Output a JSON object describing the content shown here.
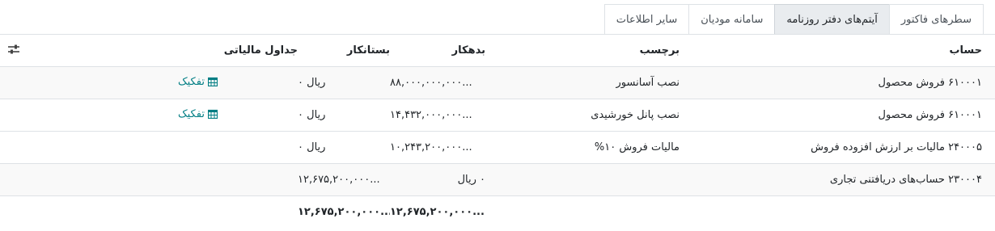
{
  "tabs": [
    {
      "label": "سطرهای فاکتور",
      "active": false
    },
    {
      "label": "آیتم‌های دفتر روزنامه",
      "active": true
    },
    {
      "label": "سامانه مودیان",
      "active": false
    },
    {
      "label": "سایر اطلاعات",
      "active": false
    }
  ],
  "table": {
    "headers": {
      "account": "حساب",
      "label": "برچسب",
      "debit": "بدهکار",
      "credit": "بستانکار",
      "tax_grids": "جداول مالیاتی"
    },
    "settings_icon": "sliders-icon",
    "rows": [
      {
        "account": "۶۱۰۰۰۱ فروش محصول",
        "label": "نصب آسانسور",
        "debit": "۸۸,۰۰۰,۰۰۰,۰۰۰...",
        "credit": "۰ ریال",
        "tax": "",
        "split": "تفکیک"
      },
      {
        "account": "۶۱۰۰۰۱ فروش محصول",
        "label": "نصب پانل خورشیدی",
        "debit": "۱۴,۴۳۲,۰۰۰,۰۰۰...",
        "credit": "۰ ریال",
        "tax": "",
        "split": "تفکیک"
      },
      {
        "account": "۲۴۰۰۰۵ مالیات بر ارزش افزوده فروش",
        "label": "مالیات فروش ۱۰%",
        "debit": "۱۰,۲۴۳,۲۰۰,۰۰۰...",
        "credit": "۰ ریال",
        "tax": "",
        "split": ""
      },
      {
        "account": "۲۳۰۰۰۴ حساب‌های دریافتنی تجاری",
        "label": "",
        "debit": "۰ ریال",
        "credit": "۱۲,۶۷۵,۲۰۰,۰۰۰...",
        "tax": "",
        "split": ""
      }
    ],
    "totals": {
      "debit": "۱۲,۶۷۵,۲۰۰,۰۰۰...",
      "credit": "۱۲,۶۷۵,۲۰۰,۰۰۰..."
    },
    "split_icon": "calendar-icon",
    "split_color": "#017e84"
  }
}
